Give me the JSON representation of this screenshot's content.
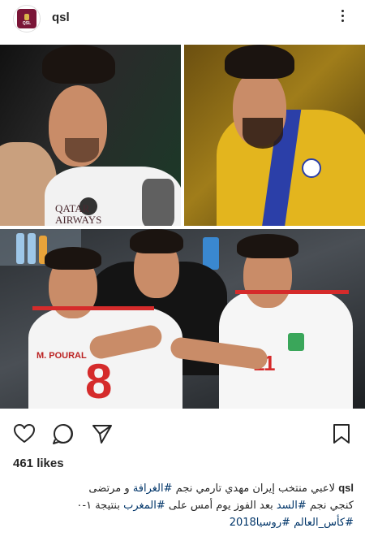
{
  "post": {
    "username": "qsl",
    "avatar_label": "QSL",
    "likes_label": "461 likes",
    "caption": {
      "line1_prefix": "لاعبي منتخب إيران مهدي تارمي نجم ",
      "line1_tag": "#الغرافة",
      "line1_mid": " و مرتضى",
      "line2_prefix": "كنجي نجم ",
      "line2_tag1": "#السد",
      "line2_mid": " بعد الفوز يوم أمس على ",
      "line2_tag2": "#المغرب",
      "line2_suffix": " بنتيجة ١-٠",
      "line3_tag1": "#كأس_العالم",
      "line3_tag2": "#روسيا2018"
    }
  },
  "photo_text": {
    "jersey_sponsor": "QATAR AIRWAYS",
    "jersey_name": "M. POURAL",
    "jersey_number": "8",
    "jersey_number2": "11"
  },
  "icons": [
    "heart-icon",
    "comment-icon",
    "share-icon",
    "bookmark-icon",
    "more-icon"
  ],
  "colors": {
    "link": "#003569",
    "text": "#262626",
    "gold_kit": "#e3b51e",
    "blue_stripe": "#2b3fa8",
    "iran_red": "#d52b2b"
  }
}
